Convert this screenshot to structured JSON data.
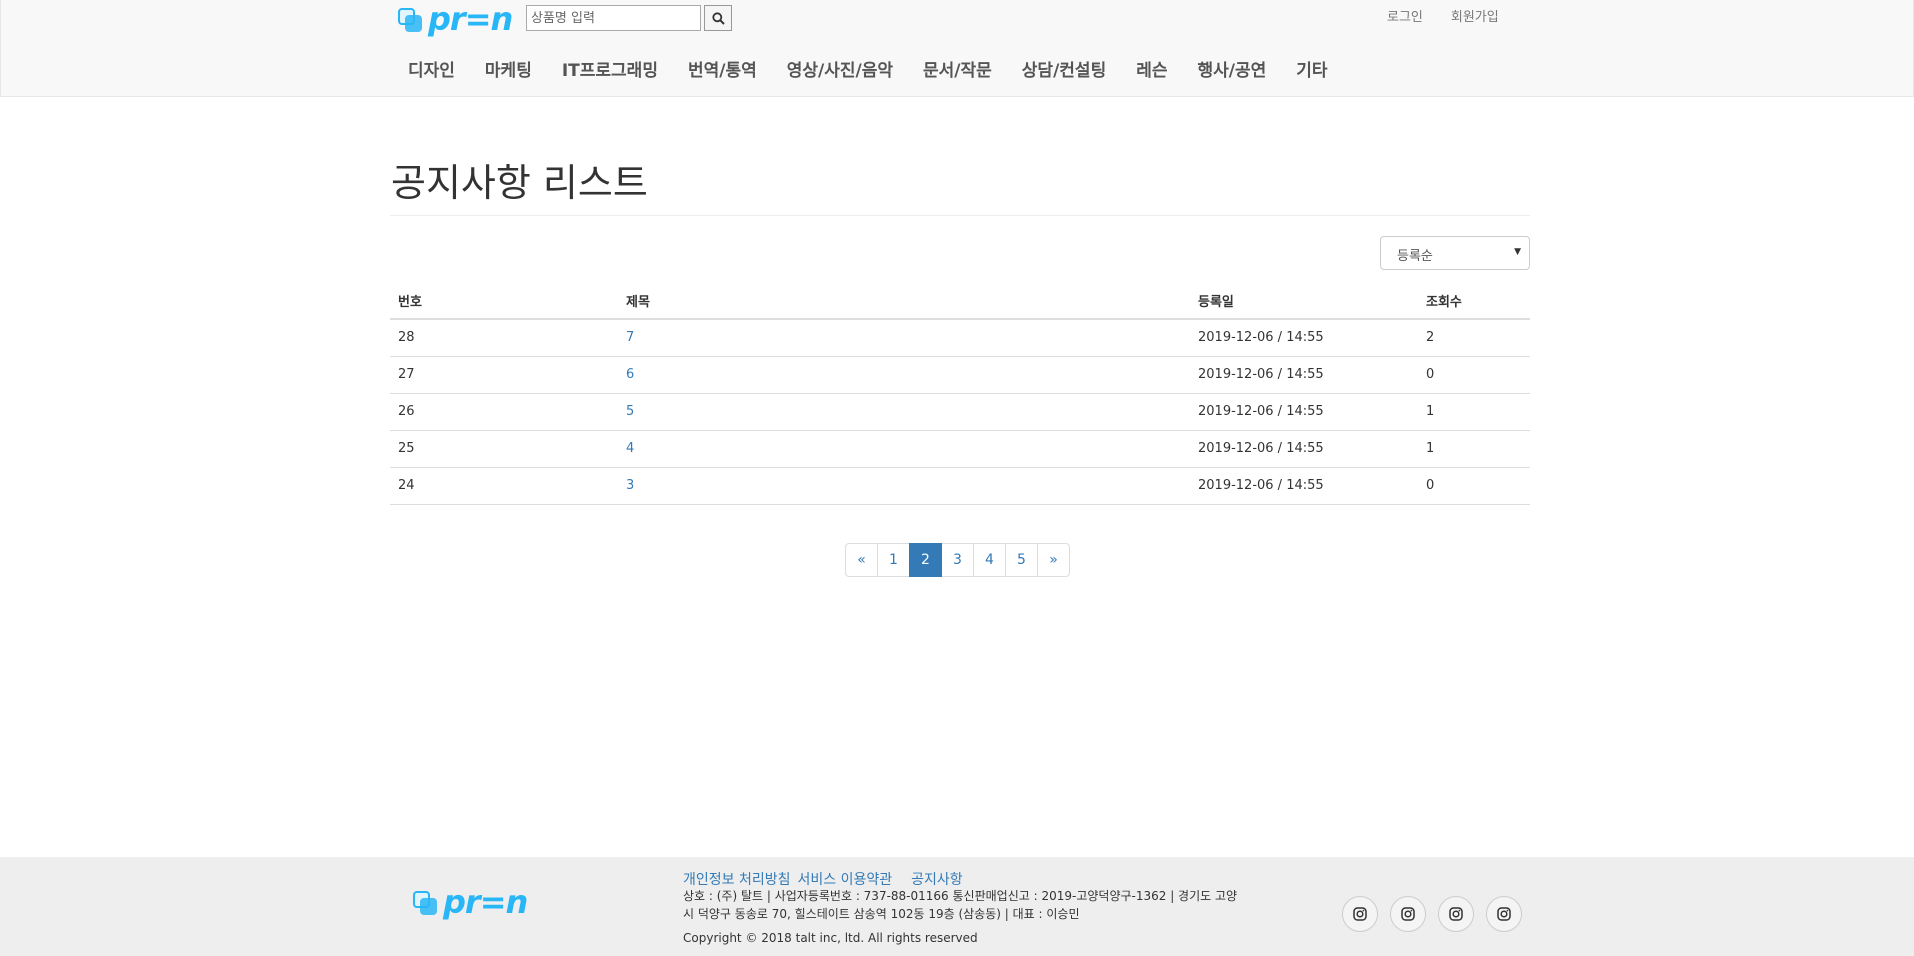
{
  "header": {
    "logo_text": "pr=n",
    "search": {
      "placeholder": "상품명 입력",
      "value": ""
    },
    "login": "로그인",
    "signup": "회원가입",
    "nav": [
      "디자인",
      "마케팅",
      "IT프로그래밍",
      "번역/통역",
      "영상/사진/음악",
      "문서/작문",
      "상담/컨설팅",
      "레슨",
      "행사/공연",
      "기타"
    ]
  },
  "main": {
    "title": "공지사항 리스트",
    "sort": {
      "selected": "등록순"
    },
    "table": {
      "headers": [
        "번호",
        "제목",
        "등록일",
        "조회수"
      ],
      "rows": [
        {
          "no": "28",
          "title": "7",
          "date": "2019-12-06 / 14:55",
          "views": "2"
        },
        {
          "no": "27",
          "title": "6",
          "date": "2019-12-06 / 14:55",
          "views": "0"
        },
        {
          "no": "26",
          "title": "5",
          "date": "2019-12-06 / 14:55",
          "views": "1"
        },
        {
          "no": "25",
          "title": "4",
          "date": "2019-12-06 / 14:55",
          "views": "1"
        },
        {
          "no": "24",
          "title": "3",
          "date": "2019-12-06 / 14:55",
          "views": "0"
        }
      ]
    },
    "pagination": {
      "prev": "«",
      "pages": [
        "1",
        "2",
        "3",
        "4",
        "5"
      ],
      "active": "2",
      "next": "»"
    }
  },
  "footer": {
    "logo_text": "pr=n",
    "links": [
      "개인정보 처리방침",
      "서비스 이용약관",
      "공지사항"
    ],
    "info_line1": "상호 : (주) 탈트 | 사업자등록번호 : 737-88-01166 통신판매업신고 : 2019-고양덕양구-1362 | 경기도 고양",
    "info_line2": "시 덕양구 동송로 70, 힐스테이트 삼송역 102동 19층 (삼송동) | 대표 : 이승민",
    "copyright": "Copyright © 2018 talt inc, ltd. All rights reserved",
    "social_icons": [
      "instagram-icon",
      "instagram-icon",
      "instagram-icon",
      "instagram-icon"
    ]
  }
}
